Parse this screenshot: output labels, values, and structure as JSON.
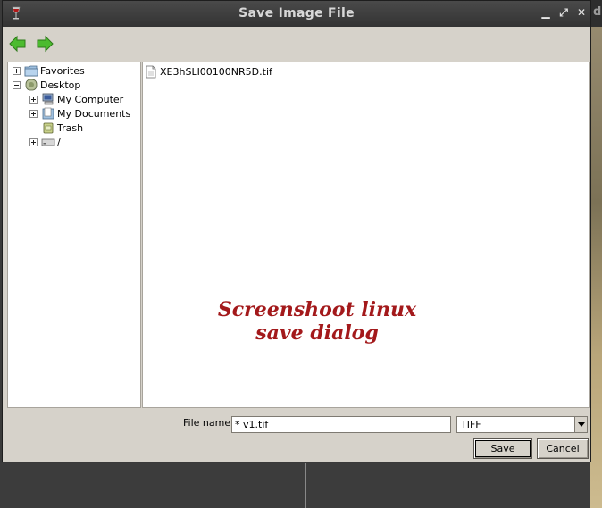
{
  "window": {
    "title": "Save Image File",
    "controls": {
      "minimize": "▁",
      "maximize": "⤢",
      "close": "✕"
    }
  },
  "toolbar": {
    "back_icon": "green-left-arrow-icon",
    "forward_icon": "green-right-arrow-icon"
  },
  "tree": {
    "items": [
      {
        "label": "Favorites",
        "icon": "folder-icon",
        "expander": "plus"
      },
      {
        "label": "Desktop",
        "icon": "desktop-icon",
        "expander": "minus"
      },
      {
        "label": "My Computer",
        "icon": "computer-icon",
        "expander": "plus"
      },
      {
        "label": "My Documents",
        "icon": "documents-icon",
        "expander": "plus"
      },
      {
        "label": "Trash",
        "icon": "trash-icon",
        "expander": "none"
      },
      {
        "label": "/",
        "icon": "drive-icon",
        "expander": "plus"
      }
    ]
  },
  "files": [
    {
      "name": "XE3hSLI00100NR5D.tif",
      "icon": "file-icon"
    }
  ],
  "watermark": {
    "line1": "Screenshoot linux",
    "line2": "save dialog"
  },
  "footer": {
    "filename_label": "File name:",
    "filename_value": "* v1.tif",
    "filetype_value": "TIFF",
    "save_label": "Save",
    "cancel_label": "Cancel"
  },
  "background": {
    "right_edge_glyph": "d"
  },
  "colors": {
    "watermark": "#a3191b",
    "nav_arrow": "#3ca62a",
    "titlebar": "#3a3a3a"
  }
}
